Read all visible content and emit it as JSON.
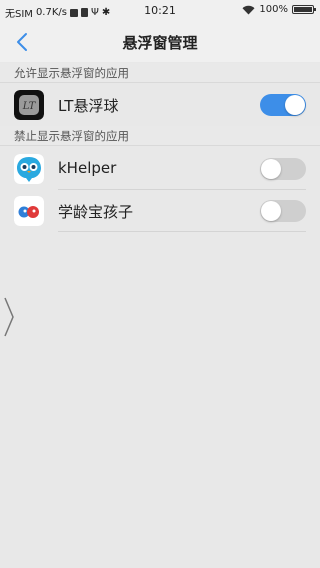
{
  "status_bar": {
    "carrier": "无SIM",
    "speed": "0.7K/s",
    "time": "10:21",
    "battery": "100%"
  },
  "nav": {
    "title": "悬浮窗管理"
  },
  "sections": {
    "allowed_header": "允许显示悬浮窗的应用",
    "blocked_header": "禁止显示悬浮窗的应用"
  },
  "apps": {
    "allowed": [
      {
        "label": "LT悬浮球",
        "icon": "lt-floating-ball-icon",
        "enabled": true
      }
    ],
    "blocked": [
      {
        "label": "kHelper",
        "icon": "khelper-icon",
        "enabled": false
      },
      {
        "label": "学龄宝孩子",
        "icon": "xuelingbao-icon",
        "enabled": false
      }
    ]
  },
  "colors": {
    "accent": "#3d8ee8",
    "background": "#e8e8e8",
    "bar": "#f0f0f0"
  }
}
